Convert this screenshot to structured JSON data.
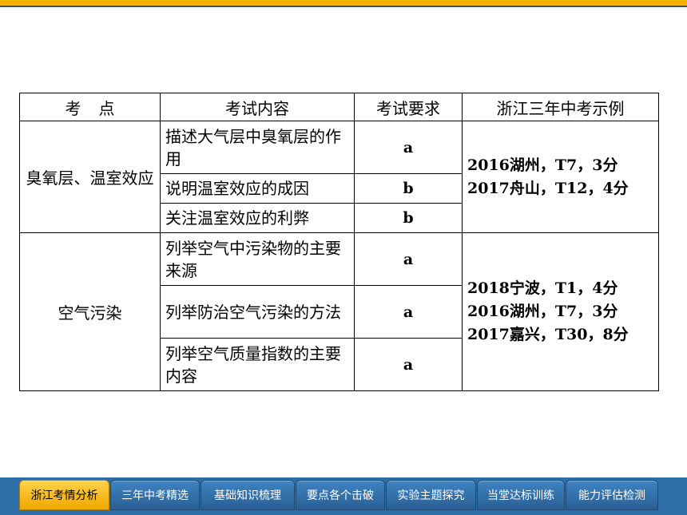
{
  "table": {
    "headers": {
      "topic_a": "考",
      "topic_b": "点",
      "content": "考试内容",
      "requirement": "考试要求",
      "examples": "浙江三年中考示例"
    },
    "groups": [
      {
        "topic": "臭氧层、温室效应",
        "rows": [
          {
            "content": "描述大气层中臭氧层的作用",
            "requirement": "a"
          },
          {
            "content": "说明温室效应的成因",
            "requirement": "b"
          },
          {
            "content": "关注温室效应的利弊",
            "requirement": "b"
          }
        ],
        "examples": [
          "2016湖州，T7，3分",
          "2017舟山，T12，4分"
        ]
      },
      {
        "topic": "空气污染",
        "rows": [
          {
            "content": "列举空气中污染物的主要来源",
            "requirement": "a"
          },
          {
            "content": "列举防治空气污染的方法",
            "requirement": "a"
          },
          {
            "content": "列举空气质量指数的主要内容",
            "requirement": "a"
          }
        ],
        "examples": [
          "2018宁波，T1，4分",
          "2016湖州，T7，3分",
          "2017嘉兴，T30，8分"
        ]
      }
    ]
  },
  "tabs": [
    {
      "label": "浙江考情分析",
      "active": true
    },
    {
      "label": "三年中考精选",
      "active": false
    },
    {
      "label": "基础知识梳理",
      "active": false
    },
    {
      "label": "要点各个击破",
      "active": false
    },
    {
      "label": "实验主题探究",
      "active": false
    },
    {
      "label": "当堂达标训练",
      "active": false
    },
    {
      "label": "能力评估检测",
      "active": false
    }
  ],
  "colors": {
    "accent_bar": "#f5b400",
    "tab_bar": "#2e6fa8",
    "active_tab": "#f0a800"
  }
}
